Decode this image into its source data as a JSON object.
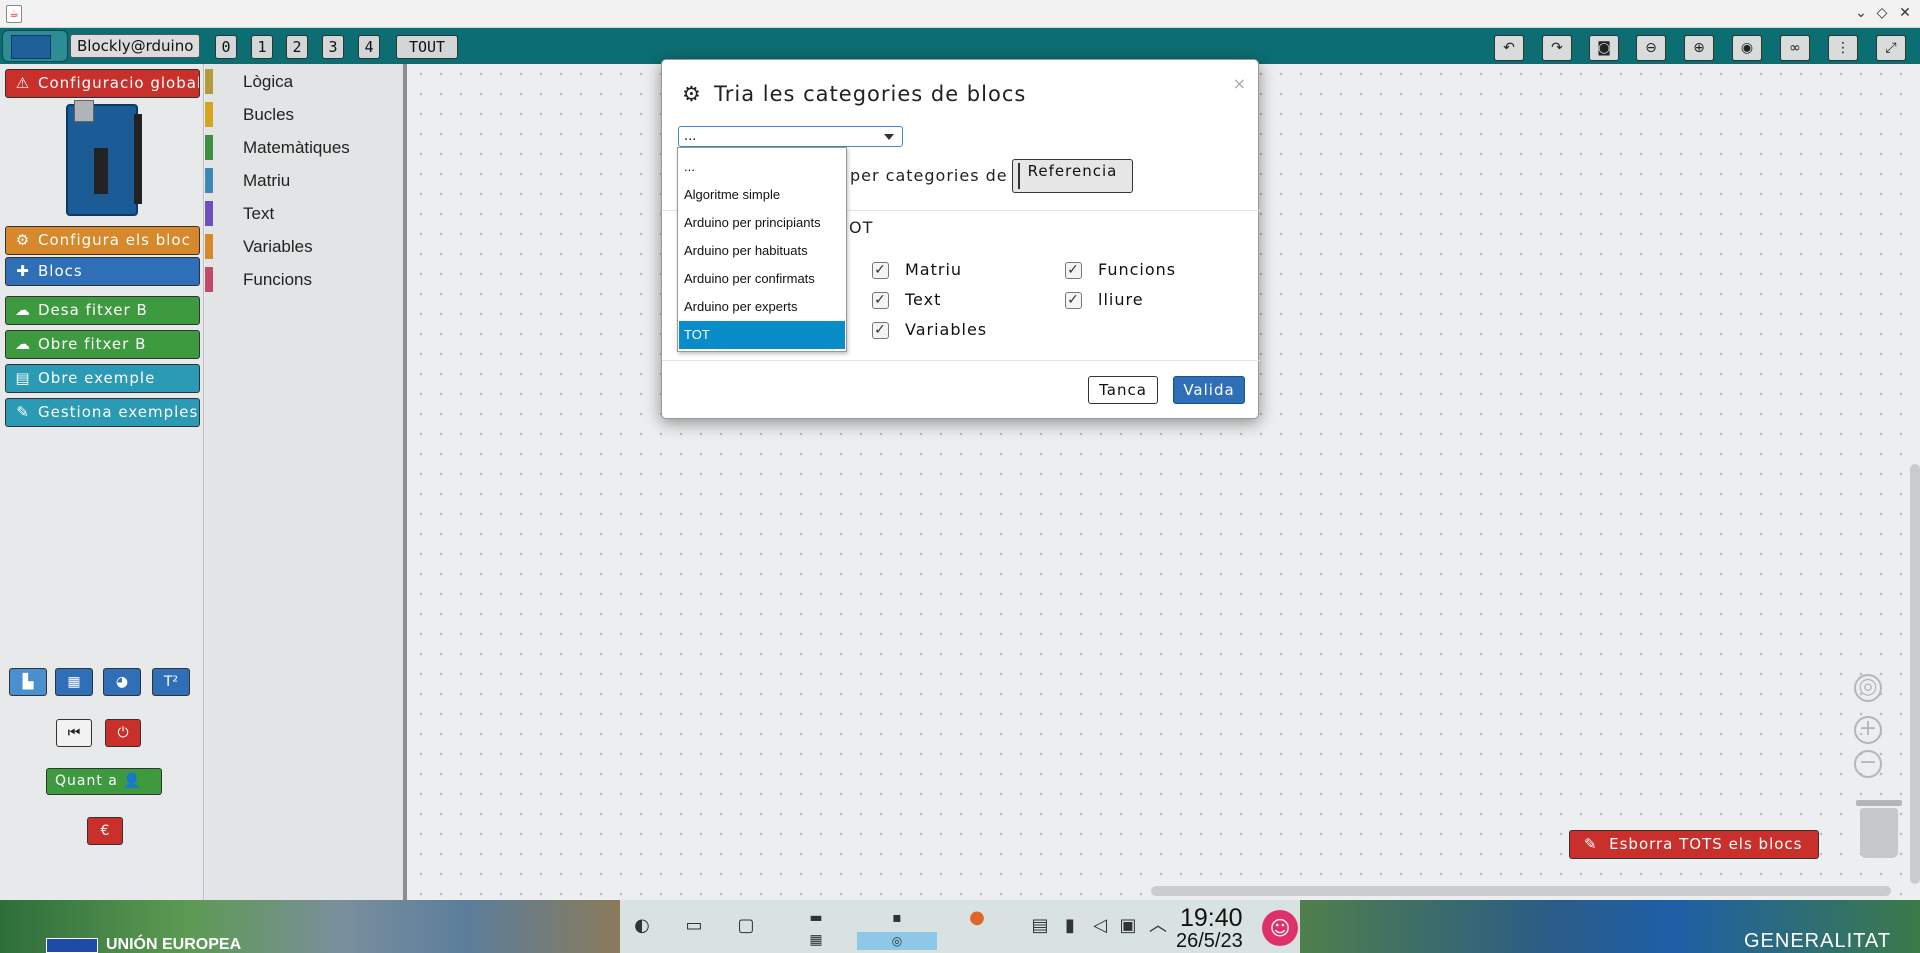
{
  "toolbar": {
    "app_name": "Blockly@rduino",
    "levels": [
      "0",
      "1",
      "2",
      "3",
      "4",
      "TOUT"
    ],
    "right_icons": [
      "undo-icon",
      "redo-icon",
      "camera-icon",
      "zoom-out-icon",
      "zoom-in-icon",
      "eye-icon",
      "link-icon",
      "more-vertical-icon",
      "fullscreen-icon"
    ]
  },
  "sidebar": {
    "config_global": "Configuracio global",
    "config_blocks": "Configura els bloc",
    "blocks": "Blocs",
    "save_file": "Desa fitxer B",
    "open_file": "Obre fitxer B",
    "open_example": "Obre exemple",
    "manage_examples": "Gestiona exemples",
    "about": "Quant a",
    "euro": "€"
  },
  "categories": [
    {
      "label": "Lògica",
      "color": "#b49a3c"
    },
    {
      "label": "Bucles",
      "color": "#d6a520"
    },
    {
      "label": "Matemàtiques",
      "color": "#3e8f3e"
    },
    {
      "label": "Matriu",
      "color": "#3c89b5"
    },
    {
      "label": "Text",
      "color": "#6f4fbf"
    },
    {
      "label": "Variables",
      "color": "#d6882a"
    },
    {
      "label": "Funcions",
      "color": "#c24a68"
    }
  ],
  "modal": {
    "title": "Tria les categories de blocs",
    "select_value": "...",
    "ref_label": "per categories de",
    "ref_button": "Referencia",
    "tot_suffix": "OT",
    "checkboxes": [
      {
        "label": "Matriu",
        "checked": true
      },
      {
        "label": "Text",
        "checked": true
      },
      {
        "label": "Variables",
        "checked": true
      },
      {
        "label": "Funcions",
        "checked": true
      },
      {
        "label": "lliure",
        "checked": true
      }
    ],
    "cancel": "Tanca",
    "ok": "Valida",
    "close": "×"
  },
  "dropdown": {
    "options": [
      "...",
      "Algoritme simple",
      "Arduino per principiants",
      "Arduino per habituats",
      "Arduino per confirmats",
      "Arduino per experts",
      "TOT"
    ],
    "selected": "TOT"
  },
  "workspace": {
    "erase_all": "Esborra TOTS els blocs"
  },
  "taskbar": {
    "time": "19:40",
    "date": "26/5/23",
    "eu_text": "UNIÓN EUROPEA",
    "generalitat": "GENERALITAT"
  }
}
